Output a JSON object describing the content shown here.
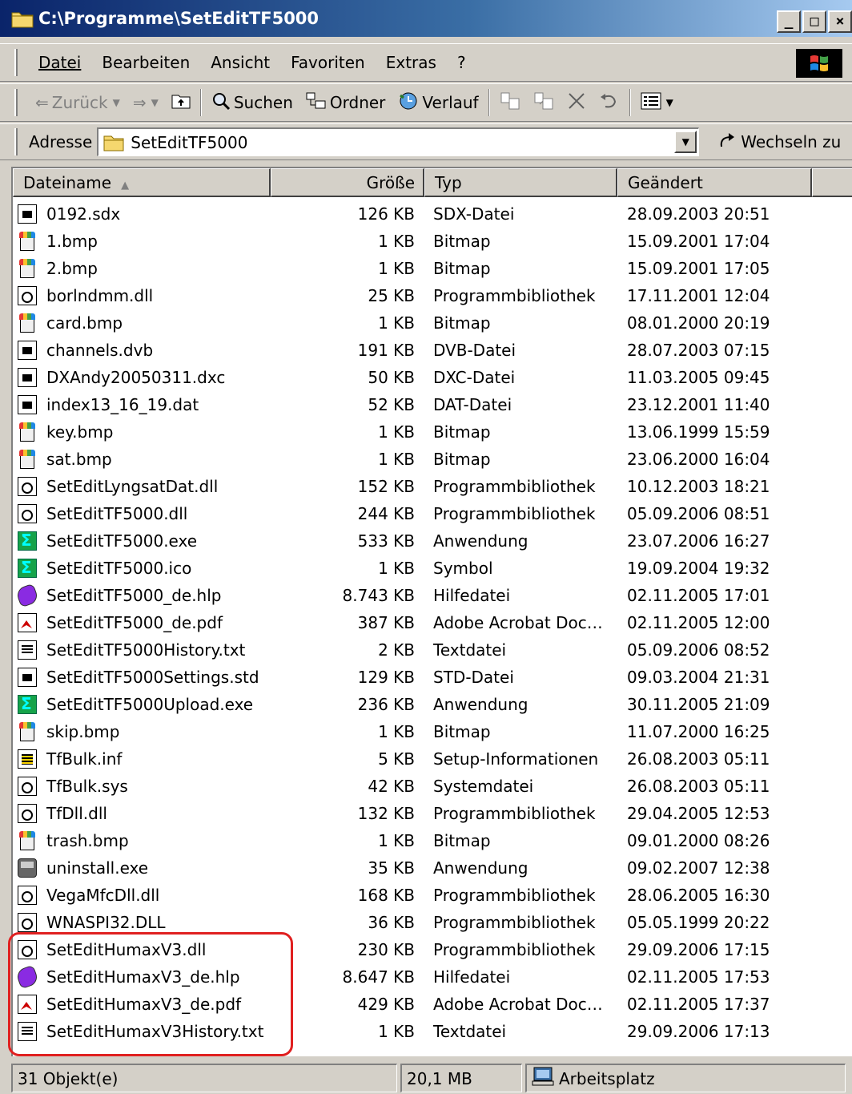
{
  "window": {
    "title": "C:\\Programme\\SetEditTF5000",
    "min_label": "_",
    "max_label": "□",
    "close_label": "×"
  },
  "menu": {
    "items": [
      {
        "label": "Datei"
      },
      {
        "label": "Bearbeiten"
      },
      {
        "label": "Ansicht"
      },
      {
        "label": "Favoriten"
      },
      {
        "label": "Extras"
      },
      {
        "label": "?"
      }
    ]
  },
  "toolbar": {
    "back_label": "Zurück",
    "search_label": "Suchen",
    "folders_label": "Ordner",
    "history_label": "Verlauf"
  },
  "address": {
    "label": "Adresse",
    "value": "SetEditTF5000",
    "go_label": "Wechseln zu"
  },
  "list": {
    "columns": {
      "name": "Dateiname",
      "size": "Größe",
      "type": "Typ",
      "modified": "Geändert"
    },
    "files": [
      {
        "name": "0192.sdx",
        "size": "126 KB",
        "type": "SDX-Datei",
        "modified": "28.09.2003 20:51",
        "icon": "generic-data-icon"
      },
      {
        "name": "1.bmp",
        "size": "1 KB",
        "type": "Bitmap",
        "modified": "15.09.2001 17:04",
        "icon": "bitmap-icon"
      },
      {
        "name": "2.bmp",
        "size": "1 KB",
        "type": "Bitmap",
        "modified": "15.09.2001 17:05",
        "icon": "bitmap-icon"
      },
      {
        "name": "borlndmm.dll",
        "size": "25 KB",
        "type": "Programmbibliothek",
        "modified": "17.11.2001 12:04",
        "icon": "dll-icon"
      },
      {
        "name": "card.bmp",
        "size": "1 KB",
        "type": "Bitmap",
        "modified": "08.01.2000 20:19",
        "icon": "bitmap-icon"
      },
      {
        "name": "channels.dvb",
        "size": "191 KB",
        "type": "DVB-Datei",
        "modified": "28.07.2003 07:15",
        "icon": "generic-data-icon"
      },
      {
        "name": "DXAndy20050311.dxc",
        "size": "50 KB",
        "type": "DXC-Datei",
        "modified": "11.03.2005 09:45",
        "icon": "generic-data-icon"
      },
      {
        "name": "index13_16_19.dat",
        "size": "52 KB",
        "type": "DAT-Datei",
        "modified": "23.12.2001 11:40",
        "icon": "generic-data-icon"
      },
      {
        "name": "key.bmp",
        "size": "1 KB",
        "type": "Bitmap",
        "modified": "13.06.1999 15:59",
        "icon": "bitmap-icon"
      },
      {
        "name": "sat.bmp",
        "size": "1 KB",
        "type": "Bitmap",
        "modified": "23.06.2000 16:04",
        "icon": "bitmap-icon"
      },
      {
        "name": "SetEditLyngsatDat.dll",
        "size": "152 KB",
        "type": "Programmbibliothek",
        "modified": "10.12.2003 18:21",
        "icon": "dll-icon"
      },
      {
        "name": "SetEditTF5000.dll",
        "size": "244 KB",
        "type": "Programmbibliothek",
        "modified": "05.09.2006 08:51",
        "icon": "dll-icon"
      },
      {
        "name": "SetEditTF5000.exe",
        "size": "533 KB",
        "type": "Anwendung",
        "modified": "23.07.2006 16:27",
        "icon": "exe-icon"
      },
      {
        "name": "SetEditTF5000.ico",
        "size": "1 KB",
        "type": "Symbol",
        "modified": "19.09.2004 19:32",
        "icon": "exe-icon"
      },
      {
        "name": "SetEditTF5000_de.hlp",
        "size": "8.743 KB",
        "type": "Hilfedatei",
        "modified": "02.11.2005 17:01",
        "icon": "help-book-icon"
      },
      {
        "name": "SetEditTF5000_de.pdf",
        "size": "387 KB",
        "type": "Adobe Acrobat Doc…",
        "modified": "02.11.2005 12:00",
        "icon": "pdf-icon"
      },
      {
        "name": "SetEditTF5000History.txt",
        "size": "2 KB",
        "type": "Textdatei",
        "modified": "05.09.2006 08:52",
        "icon": "text-file-icon"
      },
      {
        "name": "SetEditTF5000Settings.std",
        "size": "129 KB",
        "type": "STD-Datei",
        "modified": "09.03.2004 21:31",
        "icon": "generic-data-icon"
      },
      {
        "name": "SetEditTF5000Upload.exe",
        "size": "236 KB",
        "type": "Anwendung",
        "modified": "30.11.2005 21:09",
        "icon": "exe-icon"
      },
      {
        "name": "skip.bmp",
        "size": "1 KB",
        "type": "Bitmap",
        "modified": "11.07.2000 16:25",
        "icon": "bitmap-icon"
      },
      {
        "name": "TfBulk.inf",
        "size": "5 KB",
        "type": "Setup-Informationen",
        "modified": "26.08.2003 05:11",
        "icon": "setup-info-icon"
      },
      {
        "name": "TfBulk.sys",
        "size": "42 KB",
        "type": "Systemdatei",
        "modified": "26.08.2003 05:11",
        "icon": "dll-icon"
      },
      {
        "name": "TfDll.dll",
        "size": "132 KB",
        "type": "Programmbibliothek",
        "modified": "29.04.2005 12:53",
        "icon": "dll-icon"
      },
      {
        "name": "trash.bmp",
        "size": "1 KB",
        "type": "Bitmap",
        "modified": "09.01.2000 08:26",
        "icon": "bitmap-icon"
      },
      {
        "name": "uninstall.exe",
        "size": "35 KB",
        "type": "Anwendung",
        "modified": "09.02.2007 12:38",
        "icon": "uninstall-icon"
      },
      {
        "name": "VegaMfcDll.dll",
        "size": "168 KB",
        "type": "Programmbibliothek",
        "modified": "28.06.2005 16:30",
        "icon": "dll-icon"
      },
      {
        "name": "WNASPI32.DLL",
        "size": "36 KB",
        "type": "Programmbibliothek",
        "modified": "05.05.1999 20:22",
        "icon": "dll-icon"
      },
      {
        "name": "SetEditHumaxV3.dll",
        "size": "230 KB",
        "type": "Programmbibliothek",
        "modified": "29.09.2006 17:15",
        "icon": "dll-icon"
      },
      {
        "name": "SetEditHumaxV3_de.hlp",
        "size": "8.647 KB",
        "type": "Hilfedatei",
        "modified": "02.11.2005 17:53",
        "icon": "help-book-icon"
      },
      {
        "name": "SetEditHumaxV3_de.pdf",
        "size": "429 KB",
        "type": "Adobe Acrobat Doc…",
        "modified": "02.11.2005 17:37",
        "icon": "pdf-icon"
      },
      {
        "name": "SetEditHumaxV3History.txt",
        "size": "1 KB",
        "type": "Textdatei",
        "modified": "29.09.2006 17:13",
        "icon": "text-file-icon"
      }
    ]
  },
  "status": {
    "count": "31 Objekt(e)",
    "size": "20,1 MB",
    "location": "Arbeitsplatz"
  },
  "colors": {
    "title_start": "#0a246a",
    "title_end": "#a6caf0",
    "highlight": "#e02020",
    "face": "#d4d0c8"
  }
}
